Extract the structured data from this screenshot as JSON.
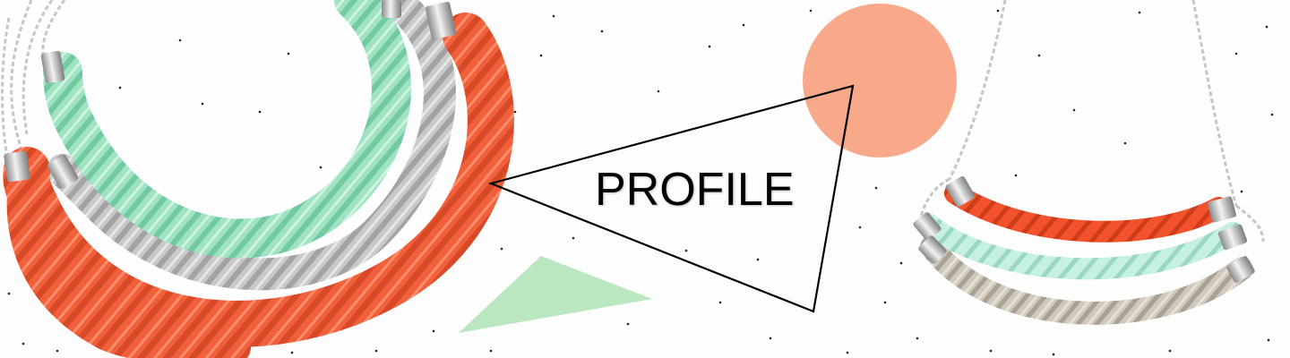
{
  "banner": {
    "title": "PROFILE",
    "colors": {
      "background": "#fdfdfd",
      "coral_circle": "#f7a98a",
      "mint_triangle": "#b6e5bd",
      "outline": "#000000",
      "coral_rope": "#f0603a",
      "mint_rope": "#98e0bf",
      "silver_rope": "#c4c4c4",
      "chain": "#c9c9c9"
    },
    "images": {
      "left": "rope-necklace-bundle-photo",
      "right": "three-strand-rope-necklace-photo"
    }
  }
}
